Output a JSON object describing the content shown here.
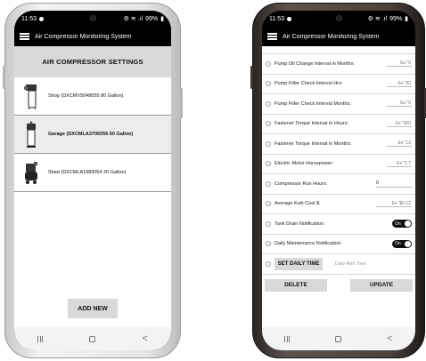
{
  "status": {
    "time": "11:53",
    "battery": "99%"
  },
  "appbar": {
    "title": "Air Compressor Monitoring System"
  },
  "left": {
    "header": "AIR COMPRESSOR SETTINGS",
    "compressors": [
      {
        "label": "Shop (DXCMV5048055 80 Gallon)",
        "selected": false
      },
      {
        "label": "Garage (DXCMLA3706056 60 Gallon)",
        "selected": true
      },
      {
        "label": "Shed (DXCMLA1983054 20 Gallon)",
        "selected": false
      }
    ],
    "add_new_label": "ADD NEW"
  },
  "right": {
    "fields": [
      {
        "label": "Pump Oil Change Interval in Months:",
        "placeholder": "Ex:\"6"
      },
      {
        "label": "Pump Filter Check Interval Hrs:",
        "placeholder": "Ex:\"50"
      },
      {
        "label": "Pump Filter Check Interval Months:",
        "placeholder": "Ex:\"6"
      },
      {
        "label": "Fastener Torque Interval in Hours:",
        "placeholder": "Ex:\"200"
      },
      {
        "label": "Fastener Torque Interval in Months:",
        "placeholder": "Ex:\"12"
      },
      {
        "label": "Electric Motor Horsepower:",
        "placeholder": "Ex:\"3.7"
      }
    ],
    "run_hours": {
      "label": "Compressor Run Hours:",
      "value": "0"
    },
    "kwh_cost": {
      "label": "Average Kwh Cost $:",
      "placeholder": "Ex:\"$0.12"
    },
    "tank_drain": {
      "label": "Tank Drain Notification:",
      "state": "On"
    },
    "daily_maint": {
      "label": "Daily Maintenance Notification:",
      "state": "On"
    },
    "daily_time": {
      "button": "SET DAILY TIME",
      "placeholder": "Daily Alert Time"
    },
    "delete_label": "DELETE",
    "update_label": "UPDATE"
  },
  "nav": {
    "recent": "|||",
    "back": "<"
  },
  "colors": {
    "appbar": "#000000",
    "button_bg": "#d9d9d9",
    "selected_row": "#ececec"
  },
  "icons": [
    "hamburger-icon",
    "compressor-icon",
    "info-icon",
    "toggle-icon",
    "home-icon",
    "back-icon",
    "recent-apps-icon"
  ]
}
